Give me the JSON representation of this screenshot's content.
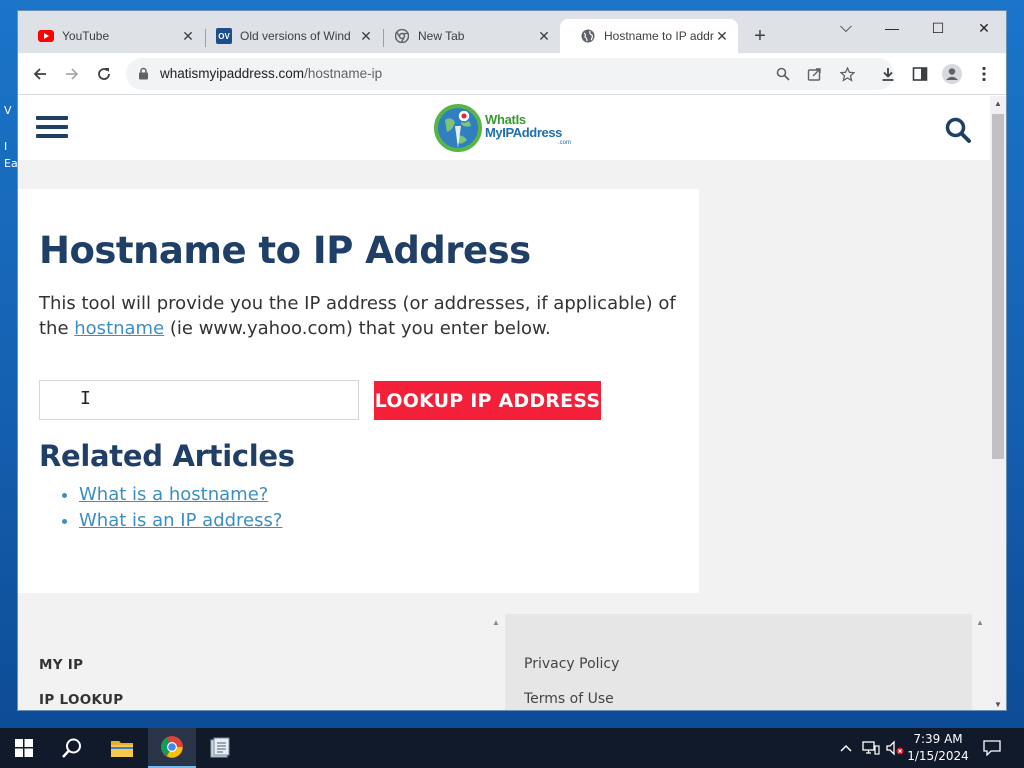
{
  "desktop": {
    "fragments": [
      "V",
      "I",
      "Ea"
    ]
  },
  "browser": {
    "tabs": [
      {
        "title": "YouTube",
        "icon": "youtube-icon",
        "active": false
      },
      {
        "title": "Old versions of Wind",
        "icon": "oldversion-icon",
        "icon_text": "OV",
        "active": false
      },
      {
        "title": "New Tab",
        "icon": "chrome-icon",
        "active": false
      },
      {
        "title": "Hostname to IP addr",
        "icon": "globe-icon",
        "active": true
      }
    ],
    "url_host": "whatismyipaddress.com",
    "url_path": "/hostname-ip",
    "window_controls": {
      "minimize": "—",
      "maximize": "☐",
      "close": "✕",
      "dropdown": "⌵"
    }
  },
  "site": {
    "logo": {
      "line1": "WhatIs",
      "line2": "MyIPAddress",
      "line3": ".com"
    },
    "title": "Hostname to IP Address",
    "intro_before": "This tool will provide you the IP address (or addresses, if applicable) of the ",
    "intro_link": "hostname",
    "intro_after": " (ie www.yahoo.com) that you enter below.",
    "input": {
      "value": "",
      "placeholder": ""
    },
    "lookup_button": "LOOKUP IP ADDRESS",
    "related_title": "Related Articles",
    "related_links": [
      "What is a hostname?",
      "What is an IP address?"
    ],
    "footer_left": [
      "MY IP",
      "IP LOOKUP"
    ],
    "footer_right": [
      "Privacy Policy",
      "Terms of Use"
    ],
    "colors": {
      "primary": "#1f3f66",
      "link": "#3b8fc4",
      "button": "#f4203a"
    }
  },
  "taskbar": {
    "time": "7:39 AM",
    "date": "1/15/2024"
  }
}
